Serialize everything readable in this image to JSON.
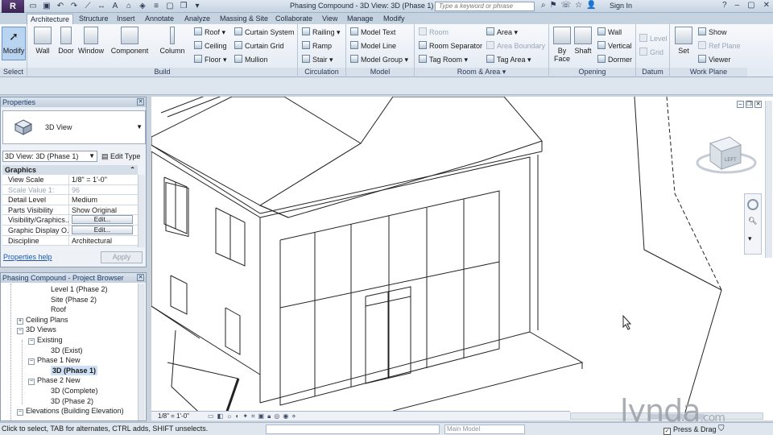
{
  "app": {
    "logo": "R",
    "doc_title": "Phasing Compound - 3D View: 3D (Phase 1)",
    "sign_in": "Sign In"
  },
  "search": {
    "placeholder": "Type a keyword or phrase"
  },
  "tabs": [
    "Architecture",
    "Structure",
    "Insert",
    "Annotate",
    "Analyze",
    "Massing & Site",
    "Collaborate",
    "View",
    "Manage",
    "Modify"
  ],
  "ribbon": {
    "select": {
      "modify": "Modify",
      "label": "Select"
    },
    "build": {
      "wall": "Wall",
      "door": "Door",
      "window": "Window",
      "component": "Component",
      "column": "Column",
      "roof": "Roof",
      "ceiling": "Ceiling",
      "floor": "Floor",
      "curtain_system": "Curtain System",
      "curtain_grid": "Curtain Grid",
      "mullion": "Mullion",
      "label": "Build"
    },
    "circulation": {
      "railing": "Railing",
      "ramp": "Ramp",
      "stair": "Stair",
      "label": "Circulation"
    },
    "model": {
      "model_text": "Model Text",
      "model_line": "Model Line",
      "model_group": "Model Group",
      "label": "Model"
    },
    "room_area": {
      "room": "Room",
      "room_separator": "Room Separator",
      "tag_room": "Tag Room",
      "area": "Area",
      "area_boundary": "Area Boundary",
      "tag_area": "Tag Area",
      "label": "Room & Area"
    },
    "opening": {
      "by_face_1": "By",
      "by_face_2": "Face",
      "shaft": "Shaft",
      "wall": "Wall",
      "vertical": "Vertical",
      "dormer": "Dormer",
      "label": "Opening"
    },
    "datum": {
      "level": "Level",
      "grid": "Grid",
      "label": "Datum"
    },
    "work_plane": {
      "set": "Set",
      "show": "Show",
      "ref_plane": "Ref Plane",
      "viewer": "Viewer",
      "label": "Work Plane"
    }
  },
  "properties": {
    "title": "Properties",
    "type_name": "3D View",
    "instance": "3D View: 3D (Phase 1)",
    "edit_type": "Edit Type",
    "group": "Graphics",
    "rows": [
      {
        "k": "View Scale",
        "v": "1/8\" = 1'-0\""
      },
      {
        "k": "Scale Value    1:",
        "v": "96"
      },
      {
        "k": "Detail Level",
        "v": "Medium"
      },
      {
        "k": "Parts Visibility",
        "v": "Show Original"
      },
      {
        "k": "Visibility/Graphics...",
        "v": "Edit..."
      },
      {
        "k": "Graphic Display O...",
        "v": "Edit..."
      },
      {
        "k": "Discipline",
        "v": "Architectural"
      }
    ],
    "help": "Properties help",
    "apply": "Apply"
  },
  "browser": {
    "title": "Phasing Compound - Project Browser",
    "nodes": [
      {
        "label": "Level 1 (Phase 2)",
        "x": 62,
        "exp": ""
      },
      {
        "label": "Site (Phase 2)",
        "x": 62,
        "exp": ""
      },
      {
        "label": "Roof",
        "x": 62,
        "exp": ""
      },
      {
        "label": "Ceiling Plans",
        "x": 34,
        "exp": "+"
      },
      {
        "label": "3D Views",
        "x": 34,
        "exp": "−"
      },
      {
        "label": "Existing",
        "x": 48,
        "exp": "−"
      },
      {
        "label": "3D (Exist)",
        "x": 62,
        "exp": ""
      },
      {
        "label": "Phase 1 New",
        "x": 48,
        "exp": "−"
      },
      {
        "label": "3D (Phase 1)",
        "x": 62,
        "exp": "",
        "sel": true
      },
      {
        "label": "Phase 2 New",
        "x": 48,
        "exp": "−"
      },
      {
        "label": "3D (Complete)",
        "x": 62,
        "exp": ""
      },
      {
        "label": "3D (Phase 2)",
        "x": 62,
        "exp": ""
      },
      {
        "label": "Elevations (Building Elevation)",
        "x": 34,
        "exp": "−"
      }
    ]
  },
  "viewbar": {
    "scale": "1/8\" = 1'-0\""
  },
  "viewcube": {
    "face": "LEFT"
  },
  "status": {
    "hint": "Click to select, TAB for alternates, CTRL adds, SHIFT unselects.",
    "workset": "Main Model",
    "press_drag": "Press & Drag"
  },
  "watermark": "lynda",
  "watermark_suffix": ".com",
  "colors": {
    "ribbon_bg": "#e2e9f2",
    "accent": "#5b3f78",
    "selection": "#cfe0f4"
  }
}
